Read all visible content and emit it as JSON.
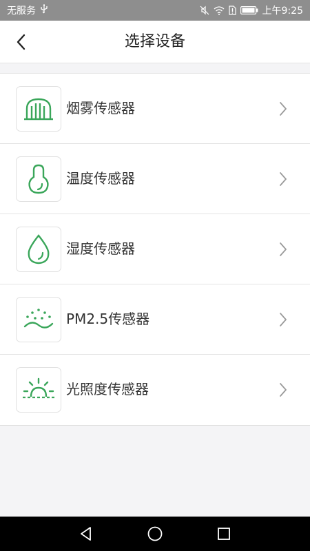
{
  "status_bar": {
    "carrier": "无服务",
    "time": "上午9:25"
  },
  "header": {
    "title": "选择设备"
  },
  "devices": [
    {
      "label": "烟雾传感器",
      "icon": "smoke-sensor-icon"
    },
    {
      "label": "温度传感器",
      "icon": "temperature-sensor-icon"
    },
    {
      "label": "湿度传感器",
      "icon": "humidity-sensor-icon"
    },
    {
      "label": "PM2.5传感器",
      "icon": "pm25-sensor-icon"
    },
    {
      "label": "光照度传感器",
      "icon": "light-sensor-icon"
    }
  ],
  "colors": {
    "icon_green": "#3aa65a",
    "status_bar_bg": "#8e8e8e",
    "nav_bar_bg": "#000000"
  }
}
